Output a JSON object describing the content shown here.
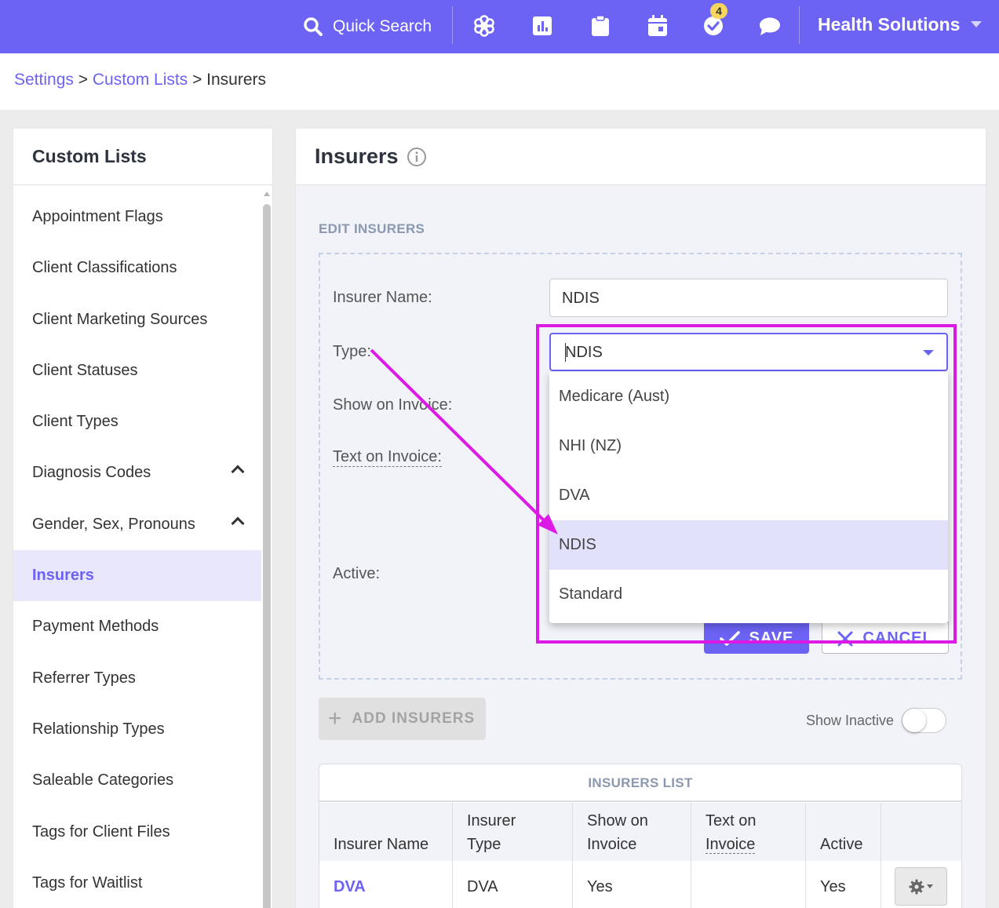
{
  "topbar": {
    "quick_search_label": "Quick Search",
    "notification_count": "4",
    "org_name": "Health Solutions",
    "icons": [
      "search-icon",
      "flower-icon",
      "reports-icon",
      "clipboard-icon",
      "calendar-icon",
      "tasks-check-icon",
      "chat-icon",
      "chevron-down-icon"
    ]
  },
  "breadcrumb": {
    "items": [
      "Settings",
      "Custom Lists",
      "Insurers"
    ],
    "separator": ">"
  },
  "sidebar": {
    "title": "Custom Lists",
    "items": [
      {
        "label": "Appointment Flags"
      },
      {
        "label": "Client Classifications"
      },
      {
        "label": "Client Marketing Sources"
      },
      {
        "label": "Client Statuses"
      },
      {
        "label": "Client Types"
      },
      {
        "label": "Diagnosis Codes",
        "expandable": true
      },
      {
        "label": "Gender, Sex, Pronouns",
        "expandable": true
      },
      {
        "label": "Insurers",
        "active": true
      },
      {
        "label": "Payment Methods"
      },
      {
        "label": "Referrer Types"
      },
      {
        "label": "Relationship Types"
      },
      {
        "label": "Saleable Categories"
      },
      {
        "label": "Tags for Client Files"
      },
      {
        "label": "Tags for Waitlist"
      }
    ]
  },
  "main": {
    "title": "Insurers",
    "section_label": "EDIT INSURERS",
    "form": {
      "insurer_name_label": "Insurer Name:",
      "insurer_name_value": "NDIS",
      "type_label": "Type:",
      "type_value": "NDIS",
      "show_on_invoice_label": "Show on Invoice:",
      "text_on_invoice_label": "Text on Invoice:",
      "active_label": "Active:"
    },
    "type_options": [
      "Medicare (Aust)",
      "NHI (NZ)",
      "DVA",
      "NDIS",
      "Standard"
    ],
    "type_selected": "NDIS",
    "save_label": "SAVE",
    "cancel_label": "CANCEL",
    "add_label": "ADD INSURERS",
    "show_inactive_label": "Show Inactive",
    "show_inactive_on": false,
    "list": {
      "title": "INSURERS LIST",
      "headers": {
        "name": "Insurer Name",
        "type_1": "Insurer",
        "type_2": "Type",
        "show_1": "Show on",
        "show_2": "Invoice",
        "text_1": "Text on",
        "text_2": "Invoice",
        "active": "Active"
      },
      "rows": [
        {
          "name": "DVA",
          "type": "DVA",
          "show_on_invoice": "Yes",
          "text_on_invoice": "",
          "active": "Yes"
        }
      ]
    }
  },
  "colors": {
    "brand": "#6c63f5",
    "annotation": "#dd19e6"
  }
}
